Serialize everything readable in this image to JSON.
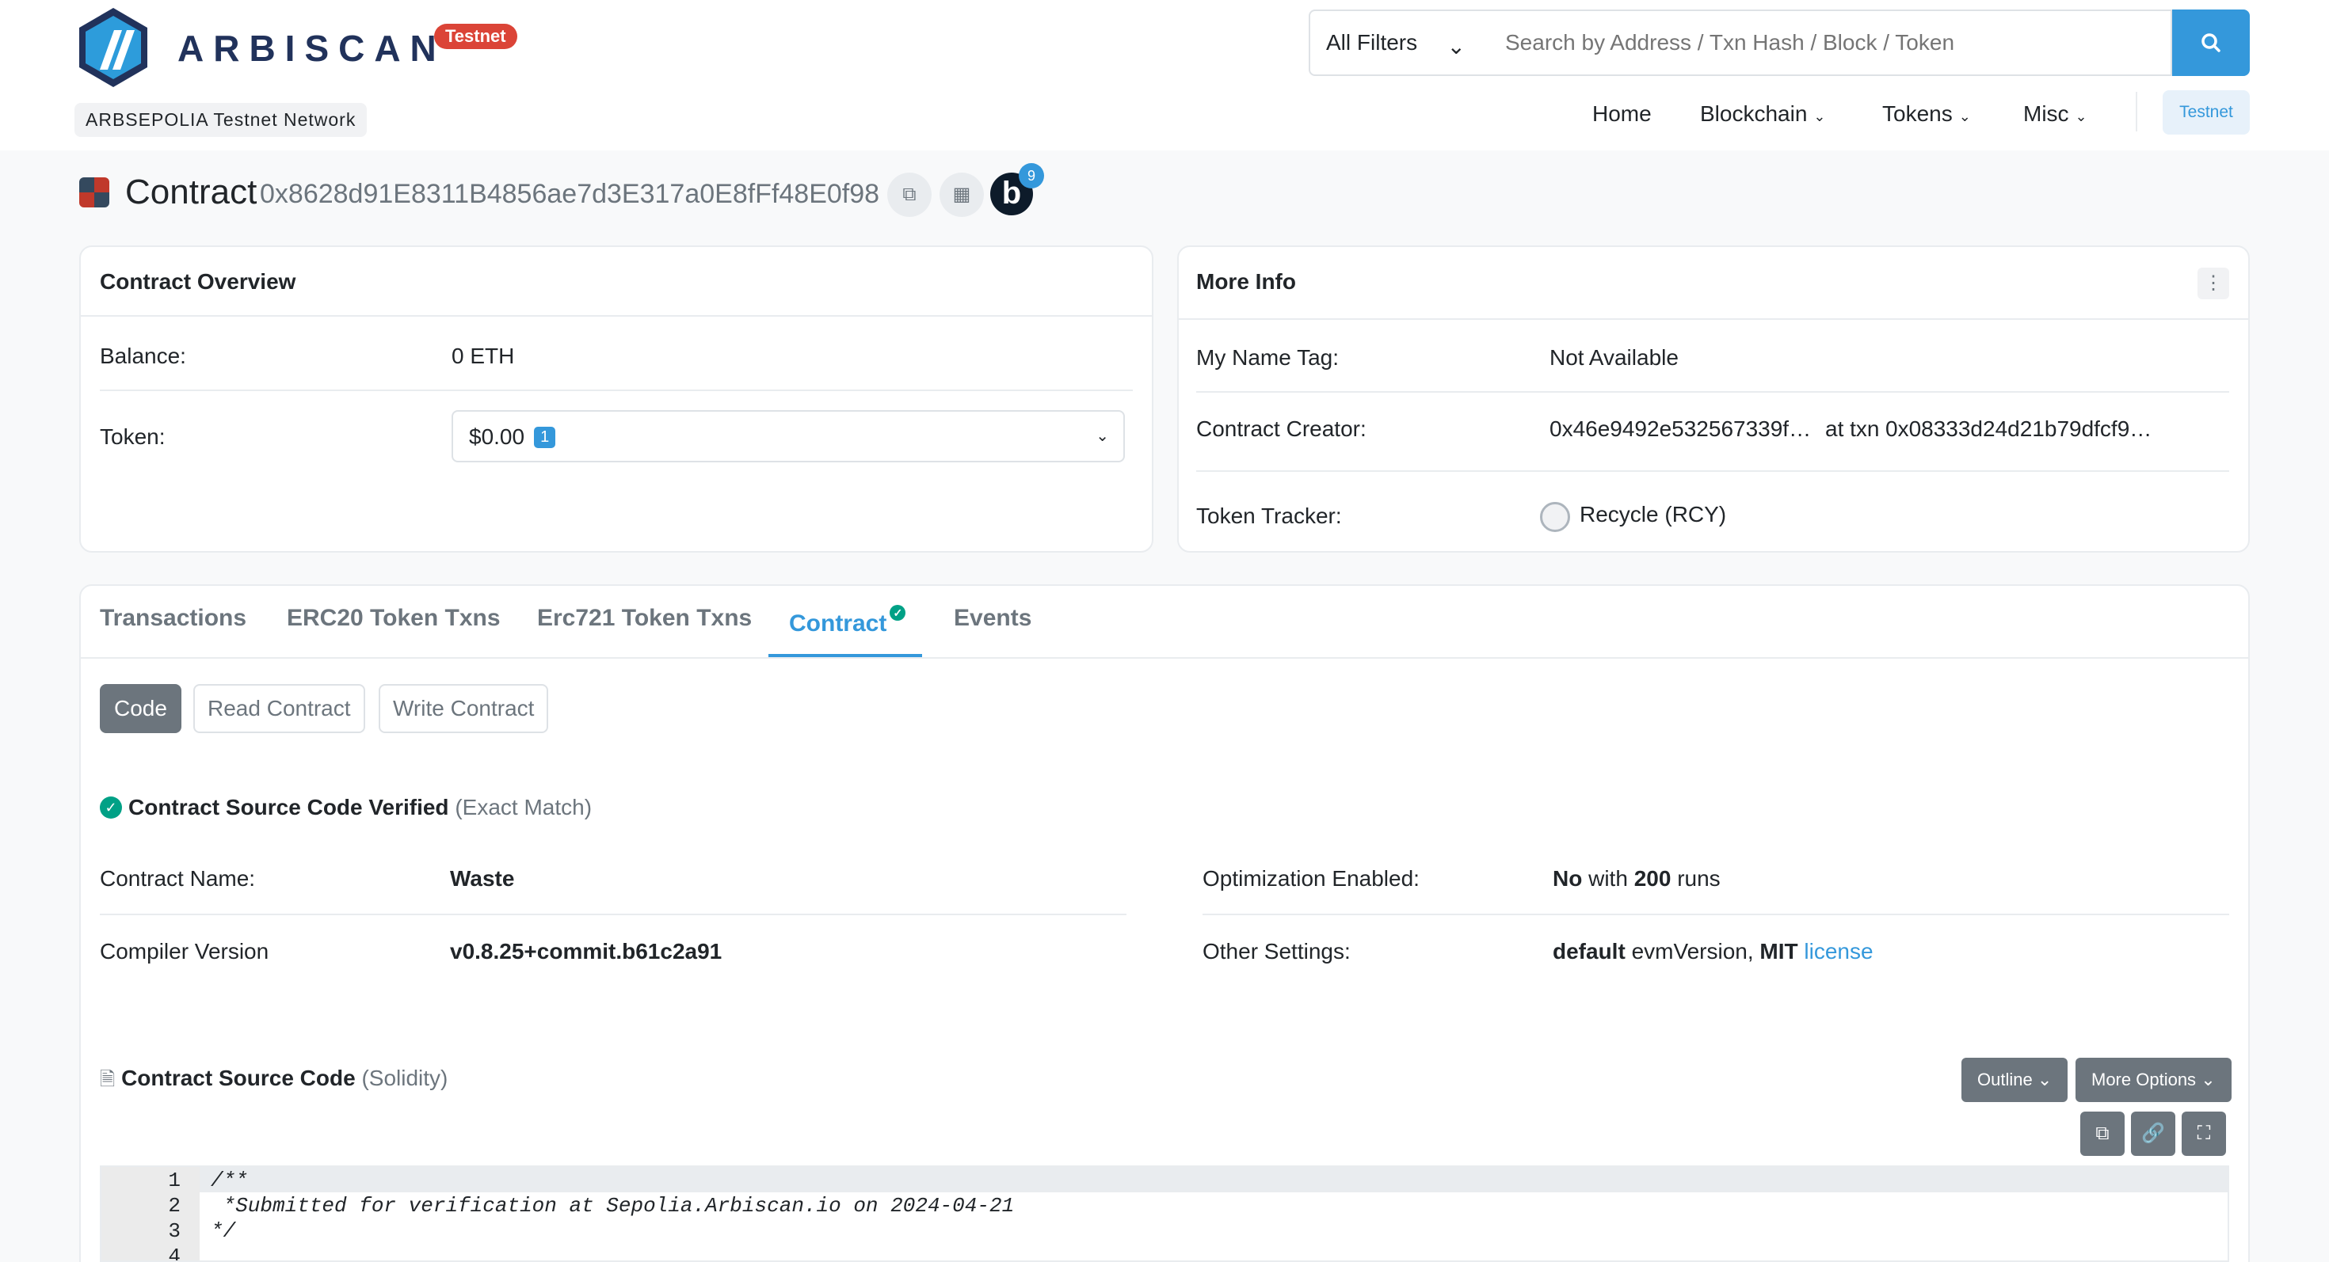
{
  "header": {
    "brand": "ARBISCAN",
    "testnet_badge": "Testnet",
    "network": "ARBSEPOLIA Testnet Network",
    "filter": "All Filters",
    "search_placeholder": "Search by Address / Txn Hash / Block / Token",
    "nav": [
      "Home",
      "Blockchain",
      "Tokens",
      "Misc"
    ],
    "nav_testnet": "Testnet"
  },
  "title": {
    "label": "Contract",
    "address": "0x8628d91E8311B4856ae7d3E317a0E8fFf48E0f98",
    "b_badge_count": "9"
  },
  "overview": {
    "title": "Contract Overview",
    "balance_label": "Balance:",
    "balance_value": "0 ETH",
    "token_label": "Token:",
    "token_value": "$0.00",
    "token_count": "1"
  },
  "more_info": {
    "title": "More Info",
    "name_tag_label": "My Name Tag:",
    "name_tag_value": "Not Available",
    "creator_label": "Contract Creator:",
    "creator_address": "0x46e9492e532567339f…",
    "at_txn": "at txn",
    "creator_txn": "0x08333d24d21b79dfcf9…",
    "tracker_label": "Token Tracker:",
    "tracker_value": "Recycle (RCY)"
  },
  "tabs": [
    "Transactions",
    "ERC20 Token Txns",
    "Erc721 Token Txns",
    "Contract",
    "Events"
  ],
  "sub_tabs": [
    "Code",
    "Read Contract",
    "Write Contract"
  ],
  "verified": {
    "title": "Contract Source Code Verified",
    "match": "(Exact Match)"
  },
  "details": {
    "name_label": "Contract Name:",
    "name_value": "Waste",
    "compiler_label": "Compiler Version",
    "compiler_value": "v0.8.25+commit.b61c2a91",
    "opt_label": "Optimization Enabled:",
    "opt_value": "No",
    "opt_with": "with",
    "opt_runs": "200",
    "opt_runs_word": "runs",
    "other_label": "Other Settings:",
    "other_default": "default",
    "other_evm": "evmVersion,",
    "other_mit": "MIT",
    "other_license": "license"
  },
  "source": {
    "title": "Contract Source Code",
    "lang": "(Solidity)",
    "outline_btn": "Outline",
    "more_btn": "More Options",
    "lines": [
      "/**",
      " *Submitted for verification at Sepolia.Arbiscan.io on 2024-04-21",
      "*/",
      ""
    ],
    "line_numbers": [
      "1",
      "2",
      "3",
      "4"
    ]
  }
}
